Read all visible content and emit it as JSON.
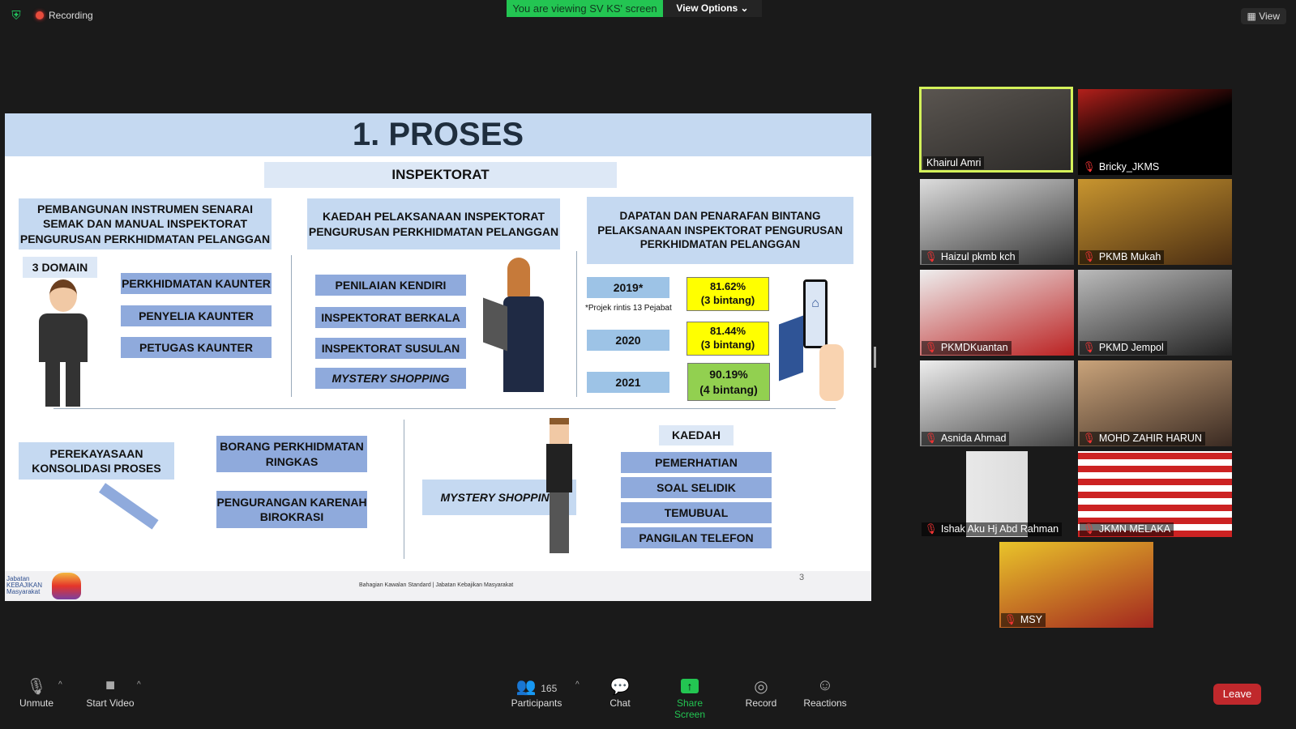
{
  "topbar": {
    "recording": "Recording",
    "viewing": "You are viewing SV KS' screen",
    "view_options": "View Options",
    "view": "View"
  },
  "slide": {
    "title": "1. PROSES",
    "section": "INSPEKTORAT",
    "col1": {
      "heading": "PEMBANGUNAN INSTRUMEN SENARAI SEMAK DAN MANUAL INSPEKTORAT PENGURUSAN PERKHIDMATAN PELANGGAN",
      "domain": "3 DOMAIN",
      "items": [
        "PERKHIDMATAN KAUNTER",
        "PENYELIA KAUNTER",
        "PETUGAS KAUNTER"
      ]
    },
    "col2": {
      "heading": "KAEDAH PELAKSANAAN INSPEKTORAT PENGURUSAN PERKHIDMATAN PELANGGAN",
      "items": [
        "PENILAIAN KENDIRI",
        "INSPEKTORAT BERKALA",
        "INSPEKTORAT SUSULAN",
        "MYSTERY SHOPPING"
      ]
    },
    "col3": {
      "heading": "DAPATAN  DAN PENARAFAN BINTANG PELAKSANAAN INSPEKTORAT PENGURUSAN PERKHIDMATAN PELANGGAN",
      "note": "*Projek rintis 13 Pejabat",
      "results": [
        {
          "year": "2019*",
          "score": "81.62%",
          "rating": "(3 bintang)",
          "color": "#ffff00"
        },
        {
          "year": "2020",
          "score": "81.44%",
          "rating": "(3 bintang)",
          "color": "#ffff00"
        },
        {
          "year": "2021",
          "score": "90.19%",
          "rating": "(4 bintang)",
          "color": "#92d050"
        }
      ]
    },
    "bottom": {
      "reengineering": "PEREKAYASAAN KONSOLIDASI PROSES",
      "form": "BORANG PERKHIDMATAN RINGKAS",
      "reduce": "PENGURANGAN KARENAH BIROKRASI",
      "mystery": "MYSTERY SHOPPING",
      "method": "KAEDAH",
      "methods": [
        "PEMERHATIAN",
        "SOAL SELIDIK",
        "TEMUBUAL",
        "PANGILAN TELEFON"
      ]
    },
    "footer": {
      "text": "Bahagian Kawalan Standard  |  Jabatan Kebajikan Masyarakat",
      "page": "3",
      "logo_text": "Jabatan KEBAJIKAN Masyarakat"
    }
  },
  "participants": [
    "Khairul Amri",
    "Bricky_JKMS",
    "Haizul pkmb kch",
    "PKMB Mukah",
    "PKMDKuantan",
    "PKMD Jempol",
    "Asnida Ahmad",
    "MOHD ZAHIR HARUN",
    "Ishak  Aku Hj Abd Rahman",
    "JKMN MELAKA",
    "MSY"
  ],
  "toolbar": {
    "unmute": "Unmute",
    "start_video": "Start Video",
    "participants_count": "165",
    "participants": "Participants",
    "chat": "Chat",
    "share_screen": "Share Screen",
    "record": "Record",
    "reactions": "Reactions",
    "leave": "Leave"
  }
}
